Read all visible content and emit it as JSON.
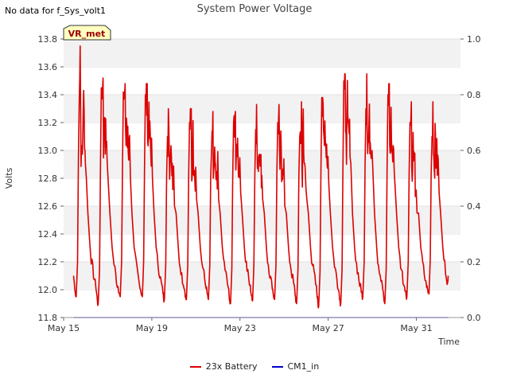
{
  "header": {
    "no_data": "No data for f_Sys_volt1",
    "title": "System Power Voltage"
  },
  "badge": {
    "label": "VR_met"
  },
  "chart_data": {
    "type": "line",
    "title": "System Power Voltage",
    "xlabel": "Time",
    "ylabel": "Volts",
    "ylim": [
      11.8,
      13.8
    ],
    "y_ticks": [
      "11.8",
      "12.0",
      "12.2",
      "12.4",
      "12.6",
      "12.8",
      "13.0",
      "13.2",
      "13.4",
      "13.6",
      "13.8"
    ],
    "y2lim": [
      0.0,
      1.0
    ],
    "y2_ticks": [
      "0.0",
      "0.2",
      "0.4",
      "0.6",
      "0.8",
      "1.0"
    ],
    "x_range_days": [
      "May 15",
      "Jun 2"
    ],
    "x_ticks": [
      "May 15",
      "May 19",
      "May 23",
      "May 27",
      "May 31"
    ],
    "grid": "horizontal bands",
    "legend": "bottom-center",
    "series": [
      {
        "name": "23x Battery",
        "color": "#dd0000",
        "axis": "left",
        "cycles": [
          {
            "start": 12.1,
            "min": 11.95,
            "peak": 13.75,
            "plateau": [
              13.38,
              12.95,
              13.1,
              13.38,
              13.0
            ]
          },
          {
            "min": 11.9,
            "peak": 13.52,
            "plateau": [
              13.45,
              13.05,
              13.28,
              13.1,
              12.95
            ]
          },
          {
            "min": 11.95,
            "peak": 13.48,
            "plateau": [
              13.42,
              13.05,
              13.25,
              13.1,
              13.0
            ]
          },
          {
            "min": 11.95,
            "peak": 13.48,
            "plateau": [
              13.4,
              13.05,
              13.2,
              13.1,
              13.0
            ]
          },
          {
            "min": 11.93,
            "peak": 13.3,
            "plateau": [
              13.1,
              12.9,
              13.1,
              12.95,
              12.8
            ]
          },
          {
            "min": 11.93,
            "peak": 13.3,
            "plateau": [
              13.2,
              12.85,
              13.1,
              12.95,
              12.85
            ]
          },
          {
            "min": 11.93,
            "peak": 13.28,
            "plateau": [
              13.0,
              12.8,
              12.9,
              12.75,
              12.85
            ]
          },
          {
            "min": 11.9,
            "peak": 13.28,
            "plateau": [
              13.2,
              12.95,
              13.1,
              12.95,
              12.9
            ]
          },
          {
            "min": 11.92,
            "peak": 13.33,
            "plateau": [
              13.15,
              12.9,
              13.1,
              12.9,
              12.85
            ]
          },
          {
            "min": 11.93,
            "peak": 13.33,
            "plateau": [
              13.2,
              12.9,
              13.05,
              12.9,
              12.8
            ]
          },
          {
            "min": 11.9,
            "peak": 13.35,
            "plateau": [
              13.1,
              12.85,
              13.2,
              12.9,
              12.85
            ]
          },
          {
            "min": 11.88,
            "peak": 13.38,
            "plateau": [
              13.38,
              13.0,
              13.2,
              13.05,
              12.95
            ]
          },
          {
            "min": 11.9,
            "peak": 13.55,
            "plateau": [
              13.5,
              13.0,
              13.4,
              13.1,
              13.1
            ]
          },
          {
            "min": 11.95,
            "peak": 13.55,
            "plateau": [
              13.3,
              13.05,
              13.2,
              13.1,
              13.05
            ]
          },
          {
            "min": 11.9,
            "peak": 13.48,
            "plateau": [
              13.4,
              13.0,
              13.2,
              13.0,
              12.95
            ]
          },
          {
            "min": 11.95,
            "peak": 13.35,
            "plateau": [
              13.2,
              12.8,
              13.05,
              12.85,
              12.75
            ]
          },
          {
            "min": 11.97,
            "peak": 13.35,
            "plateau": [
              13.1,
              12.95,
              13.05,
              12.95,
              12.9
            ],
            "end": 12.1
          }
        ]
      },
      {
        "name": "CM1_in",
        "color": "#0000cc",
        "axis": "right",
        "values_constant": 0.0
      }
    ]
  }
}
